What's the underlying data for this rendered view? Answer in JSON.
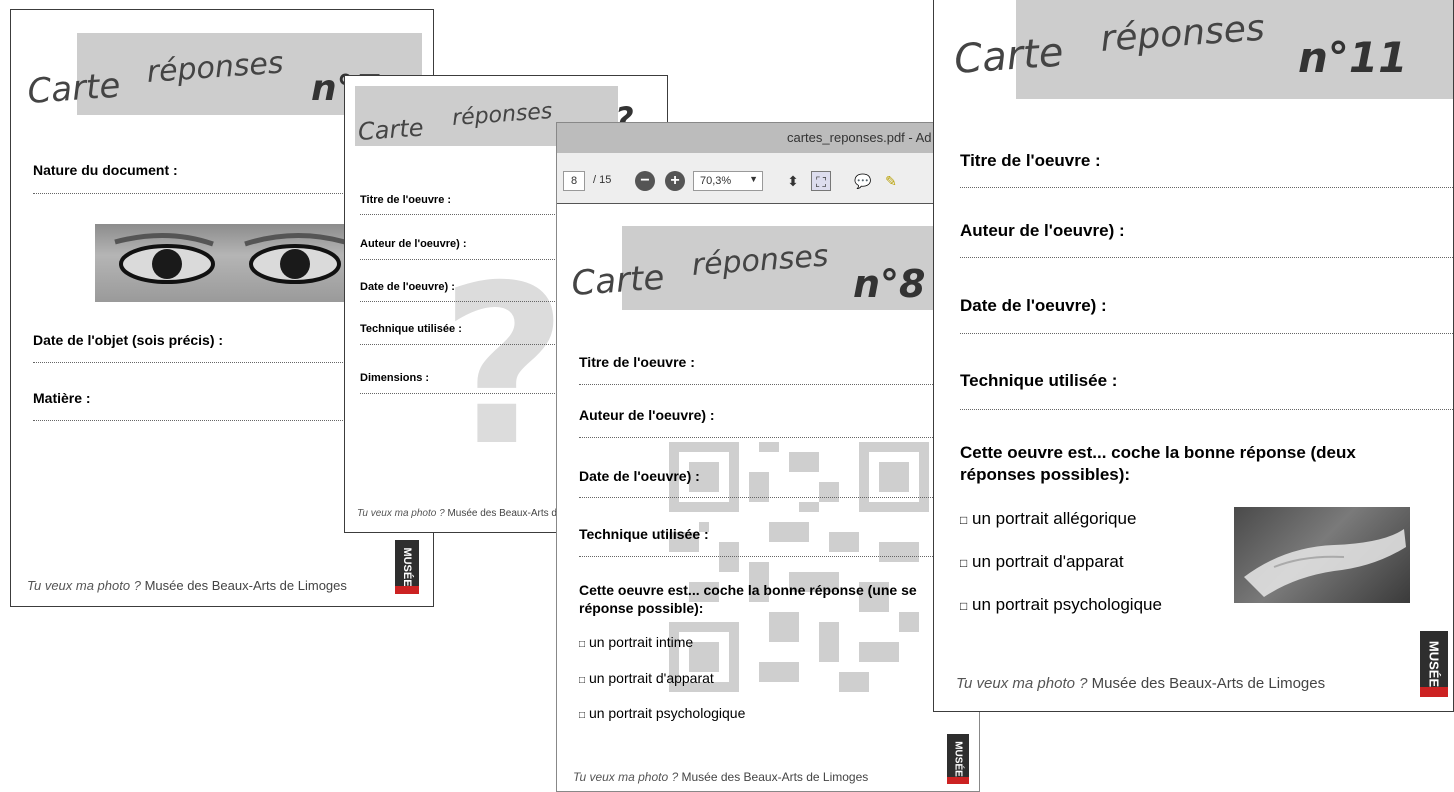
{
  "common": {
    "carte": "Carte",
    "reponses": "réponses",
    "footer_italic": "Tu veux ma photo ?",
    "footer_rest": "Musée des Beaux-Arts de Limoges",
    "logo_text": "MUSÉE",
    "check_box": "□"
  },
  "card7": {
    "number": "n°7",
    "fields": [
      "Nature du document :",
      "Date de l'objet (sois précis) :",
      "Matière :"
    ]
  },
  "card_q": {
    "number": "?",
    "fields": [
      "Titre de l'oeuvre :",
      "Auteur de l'oeuvre) :",
      "Date de l'oeuvre) :",
      "Technique utilisée :",
      "Dimensions :"
    ]
  },
  "pdf": {
    "title": "cartes_reponses.pdf - Ad",
    "page_current": "8",
    "page_total": "/ 15",
    "zoom": "70,3%"
  },
  "card8": {
    "number": "n°8",
    "fields": [
      "Titre de l'oeuvre :",
      "Auteur de l'oeuvre) :",
      "Date de l'oeuvre) :",
      "Technique utilisée :"
    ],
    "question": "Cette oeuvre est... coche la bonne réponse (une se réponse possible):",
    "question_l1": "Cette oeuvre est... coche la bonne réponse (une se",
    "question_l2": "réponse possible):",
    "options": [
      "un portrait intime",
      "un portrait d'apparat",
      "un portrait psychologique"
    ]
  },
  "card11": {
    "number": "n°11",
    "fields": [
      "Titre de l'oeuvre :",
      "Auteur de l'oeuvre) :",
      "Date de l'oeuvre) :",
      "Technique utilisée :"
    ],
    "question_l1": "Cette oeuvre est... coche la bonne réponse (deux",
    "question_l2": "réponses possibles):",
    "options": [
      "un portrait allégorique",
      "un portrait d'apparat",
      "un portrait psychologique"
    ]
  }
}
